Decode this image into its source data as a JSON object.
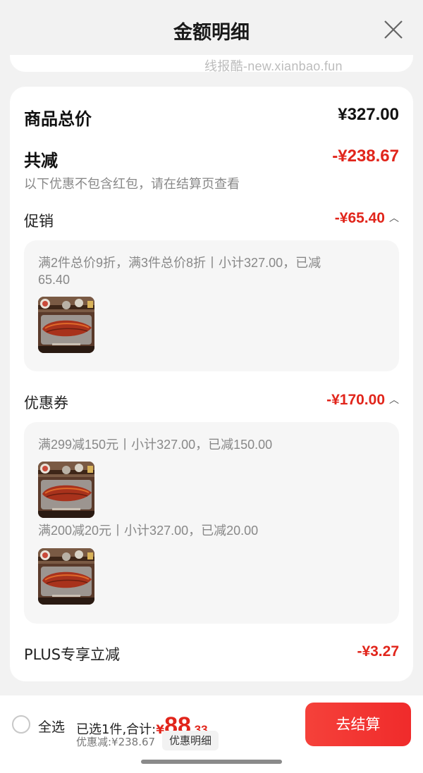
{
  "header": {
    "title": "金额明细"
  },
  "watermark": "线报酷-new.xianbao.fun",
  "summary": {
    "total_label": "商品总价",
    "total_value": "¥327.00",
    "reduction_label": "共减",
    "reduction_value": "-¥238.67",
    "note": "以下优惠不包含红包，请在结算页查看"
  },
  "promotion": {
    "label": "促销",
    "value": "-¥65.40",
    "detail_line1": "满2件总价9折，满3件总价8折丨小计327.00，已减",
    "detail_line2": "65.40"
  },
  "coupon": {
    "label": "优惠券",
    "value": "-¥170.00",
    "items": [
      {
        "text": "满299减150元丨小计327.00，已减150.00"
      },
      {
        "text": "满200减20元丨小计327.00，已减20.00"
      }
    ]
  },
  "plus": {
    "label": "PLUS专享立减",
    "value": "-¥3.27"
  },
  "bottom": {
    "select_all": "全选",
    "selected_prefix": "已选1件,合计:",
    "currency": "¥",
    "price_int": "88",
    "price_dec": ".33",
    "discount_text": "优惠减:¥238.67",
    "detail_chip": "优惠明细",
    "checkout": "去结算"
  },
  "colors": {
    "accent_red": "#e1251b",
    "checkout_button": "#f23030"
  },
  "icons": [
    "close-icon",
    "chevron-up-icon",
    "eel-product-thumbnail"
  ]
}
